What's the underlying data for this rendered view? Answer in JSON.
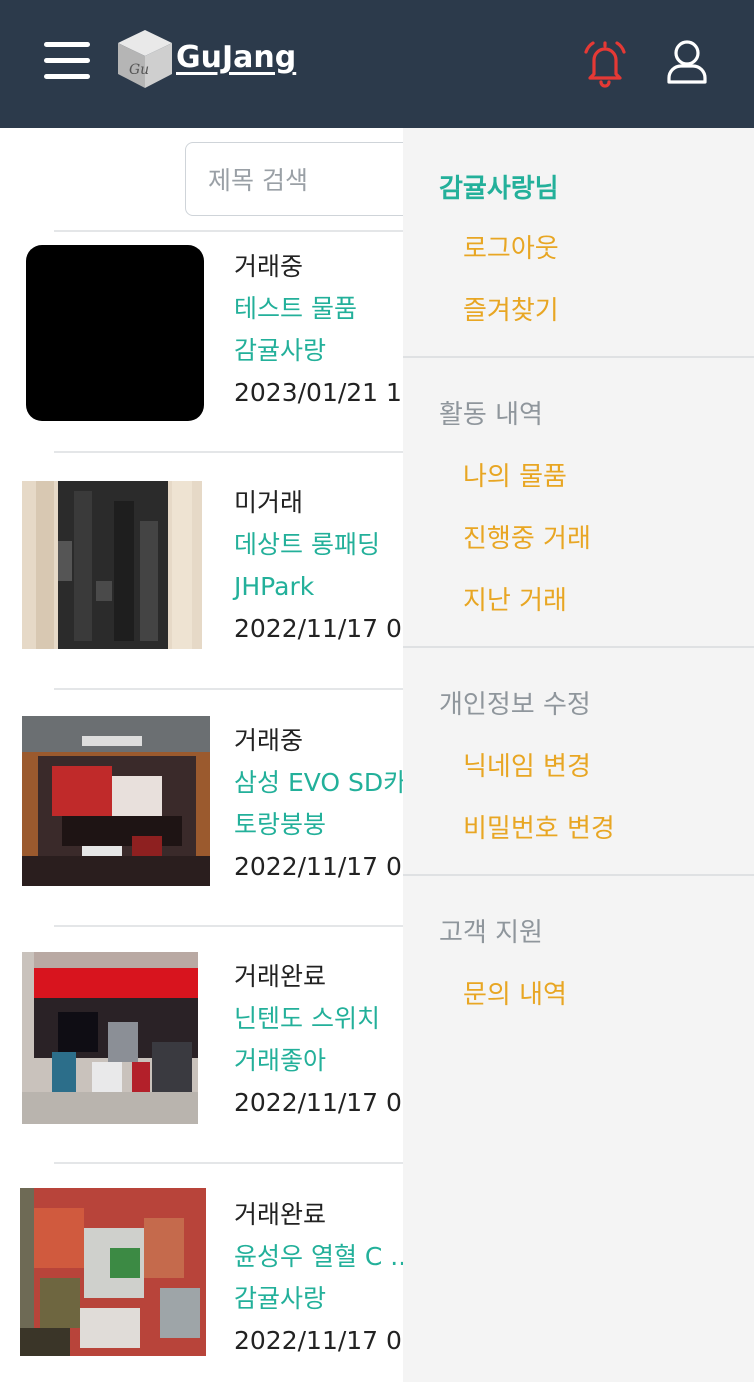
{
  "header": {
    "logo_text": "GuJang",
    "logo_badge": "Gu",
    "colors": {
      "bar": "#2c3a4b",
      "bell": "#e53935"
    },
    "icons": [
      "menu-icon",
      "bell-icon",
      "user-icon"
    ]
  },
  "search": {
    "placeholder": "제목 검색"
  },
  "items": [
    {
      "status": "거래중",
      "title": "테스트 물품",
      "seller": "감귤사랑",
      "date": "2023/01/21 1"
    },
    {
      "status": "미거래",
      "title": "데상트 롱패딩",
      "seller": "JHPark",
      "date": "2022/11/17 0"
    },
    {
      "status": "거래중",
      "title": "삼성 EVO SD카",
      "seller": "토랑붕붕",
      "date": "2022/11/17 0"
    },
    {
      "status": "거래완료",
      "title": "닌텐도 스위치",
      "seller": "거래좋아",
      "date": "2022/11/17 0"
    },
    {
      "status": "거래완료",
      "title": "윤성우 열혈 C ..",
      "seller": "감귤사랑",
      "date": "2022/11/17 0"
    }
  ],
  "menu": {
    "user_name": "감귤사랑님",
    "account": [
      "로그아웃",
      "즐겨찾기"
    ],
    "activity": {
      "title": "활동 내역",
      "items": [
        "나의 물품",
        "진행중 거래",
        "지난 거래"
      ]
    },
    "profile": {
      "title": "개인정보 수정",
      "items": [
        "닉네임 변경",
        "비밀번호 변경"
      ]
    },
    "support": {
      "title": "고객 지원",
      "items": [
        "문의 내역"
      ]
    },
    "colors": {
      "accent": "#23b09a",
      "link": "#e8a623",
      "section": "#8f969c"
    }
  }
}
